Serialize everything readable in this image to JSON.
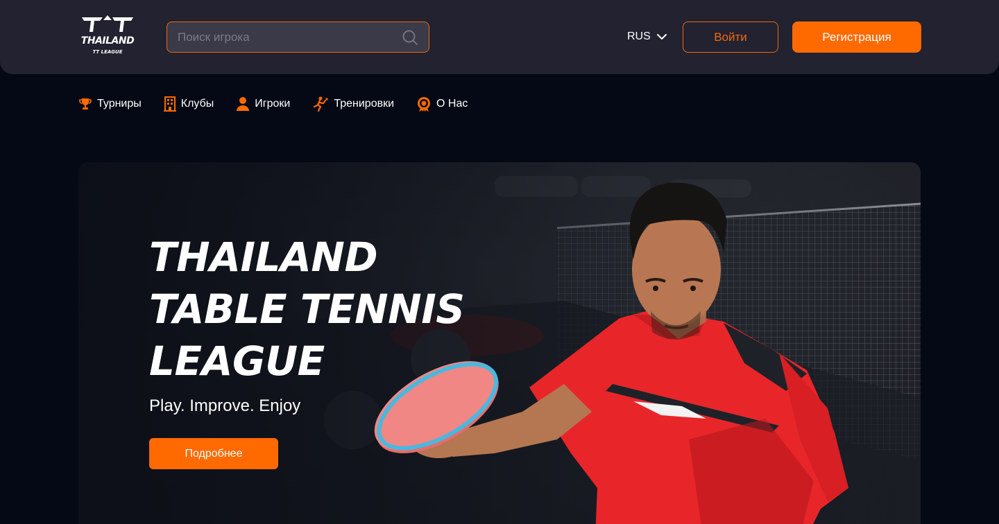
{
  "brand": {
    "logo_main": "THAILAND",
    "logo_sub": "TT LEAGUE",
    "accent": "#ff6a00"
  },
  "header": {
    "search_placeholder": "Поиск игрока",
    "search_icon": "search-icon",
    "language": "RUS",
    "language_icon": "chevron-down-icon",
    "login_label": "Войти",
    "register_label": "Регистрация"
  },
  "nav": {
    "items": [
      {
        "label": "Турниры",
        "icon": "trophy-icon"
      },
      {
        "label": "Клубы",
        "icon": "building-icon"
      },
      {
        "label": "Игроки",
        "icon": "user-icon"
      },
      {
        "label": "Тренировки",
        "icon": "training-icon"
      },
      {
        "label": "О Нас",
        "icon": "badge-icon"
      }
    ]
  },
  "hero": {
    "title_lines": [
      "THAILAND",
      "TABLE TENNIS",
      "LEAGUE"
    ],
    "subtitle": "Play. Improve. Enjoy",
    "cta_label": "Подробнее"
  }
}
